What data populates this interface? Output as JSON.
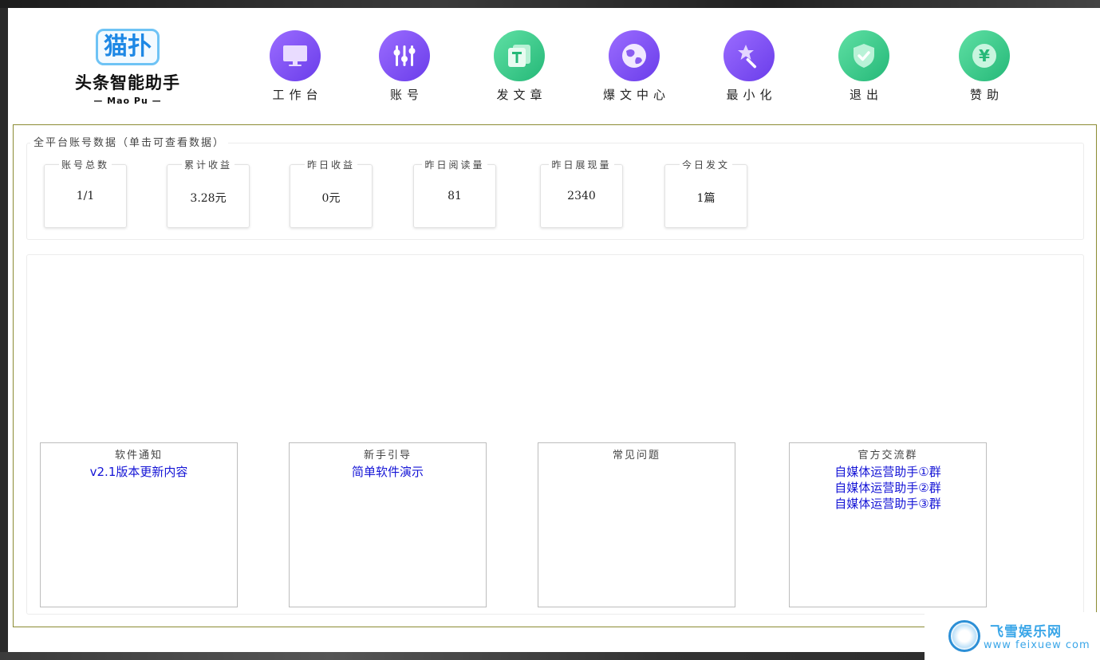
{
  "logo": {
    "badge": "猫扑",
    "name": "头条智能助手",
    "sub": "— Mao Pu —"
  },
  "toolbar": [
    {
      "label": "工作台",
      "icon": "monitor-icon"
    },
    {
      "label": "账号",
      "icon": "sliders-icon"
    },
    {
      "label": "发文章",
      "icon": "article-icon"
    },
    {
      "label": "爆文中心",
      "icon": "globe-icon"
    },
    {
      "label": "最小化",
      "icon": "magic-wand-icon"
    },
    {
      "label": "退出",
      "icon": "shield-check-icon"
    },
    {
      "label": "赞助",
      "icon": "yuan-coin-icon"
    }
  ],
  "stats": {
    "title": "全平台账号数据（单击可查看数据）",
    "items": [
      {
        "label": "账号总数",
        "value": "1/1"
      },
      {
        "label": "累计收益",
        "value": "3.28元"
      },
      {
        "label": "昨日收益",
        "value": "0元"
      },
      {
        "label": "昨日阅读量",
        "value": "81"
      },
      {
        "label": "昨日展现量",
        "value": "2340"
      },
      {
        "label": "今日发文",
        "value": "1篇"
      }
    ]
  },
  "panels": [
    {
      "title": "软件通知",
      "links": [
        "v2.1版本更新内容"
      ]
    },
    {
      "title": "新手引导",
      "links": [
        "简单软件演示"
      ]
    },
    {
      "title": "常见问题",
      "links": []
    },
    {
      "title": "官方交流群",
      "links": [
        "自媒体运营助手①群",
        "自媒体运营助手②群",
        "自媒体运营助手③群"
      ]
    }
  ],
  "watermark": {
    "name": "飞雪娱乐网",
    "url": "www feixuew com"
  },
  "colors": {
    "purple_accent": "#7b4cf2",
    "green_accent": "#34c98a",
    "link_blue": "#1414d6",
    "frame_olive": "#8b8b33"
  }
}
